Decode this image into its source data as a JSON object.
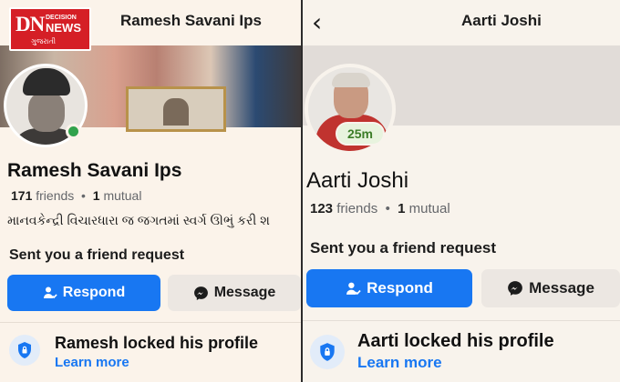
{
  "left": {
    "logo": {
      "dn": "DN",
      "decision": "DECISION",
      "news": "NEWS",
      "gujarati": "ગુજરાતી"
    },
    "header_title": "Ramesh Savani Ips",
    "name": "Ramesh Savani Ips",
    "friends_count": "171",
    "friends_label": "friends",
    "mutual_count": "1",
    "mutual_label": "mutual",
    "bio": "માનવકેન્દ્રી વિચારધારા જ જગતમાં સ્વર્ગ ઊભું કરી શ",
    "request_text": "Sent you a friend request",
    "respond_label": "Respond",
    "message_label": "Message",
    "locked_text": "Ramesh locked his profile",
    "learn_more": "Learn more"
  },
  "right": {
    "header_title": "Aarti Joshi",
    "time_badge": "25m",
    "name": "Aarti Joshi",
    "friends_count": "123",
    "friends_label": "friends",
    "mutual_count": "1",
    "mutual_label": "mutual",
    "request_text": "Sent you a friend request",
    "respond_label": "Respond",
    "message_label": "Message",
    "locked_text": "Aarti locked his profile",
    "learn_more": "Learn more"
  },
  "colors": {
    "accent": "#1877f2",
    "online": "#31a24c",
    "badge_text": "#3c7d28"
  },
  "icons": [
    "back-chevron-icon",
    "respond-user-icon",
    "messenger-icon",
    "shield-lock-icon",
    "online-status-icon"
  ]
}
